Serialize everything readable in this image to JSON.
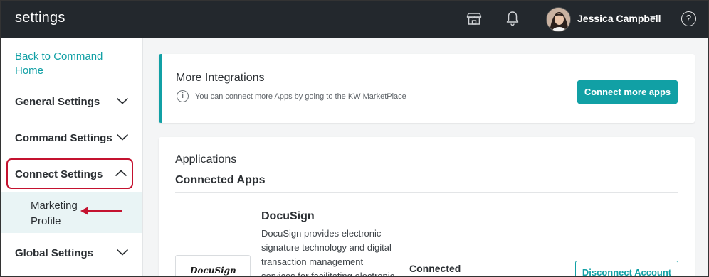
{
  "header": {
    "title": "settings",
    "user_name": "Jessica Campbell",
    "help_glyph": "?",
    "icons": [
      "store-icon",
      "bell-icon",
      "avatar",
      "caret-down-icon",
      "help-icon"
    ]
  },
  "sidebar": {
    "back_link": "Back to Command Home",
    "items": [
      {
        "label": "General Settings",
        "state": "collapsed"
      },
      {
        "label": "Command Settings",
        "state": "collapsed"
      },
      {
        "label": "Connect Settings",
        "state": "expanded"
      },
      {
        "label": "Global Settings",
        "state": "collapsed"
      }
    ],
    "sub_items": [
      {
        "label": "Marketing Profile"
      }
    ]
  },
  "integrations": {
    "title": "More Integrations",
    "info_glyph": "i",
    "description": "You can connect more Apps by going to the KW MarketPlace",
    "button_label": "Connect more apps"
  },
  "applications": {
    "section_title": "Applications",
    "subsection_title": "Connected Apps",
    "apps": [
      {
        "name": "DocuSign",
        "description": "DocuSign provides electronic signature technology and digital transaction management services for facilitating electronic",
        "logo_text": "DocuSign",
        "status": "Connected",
        "action_label": "Disconnect Account"
      }
    ]
  },
  "colors": {
    "topbar": "#23282d",
    "accent": "#11a0a5",
    "highlight": "#c4122f",
    "sidebar_active": "#e9f4f5"
  }
}
